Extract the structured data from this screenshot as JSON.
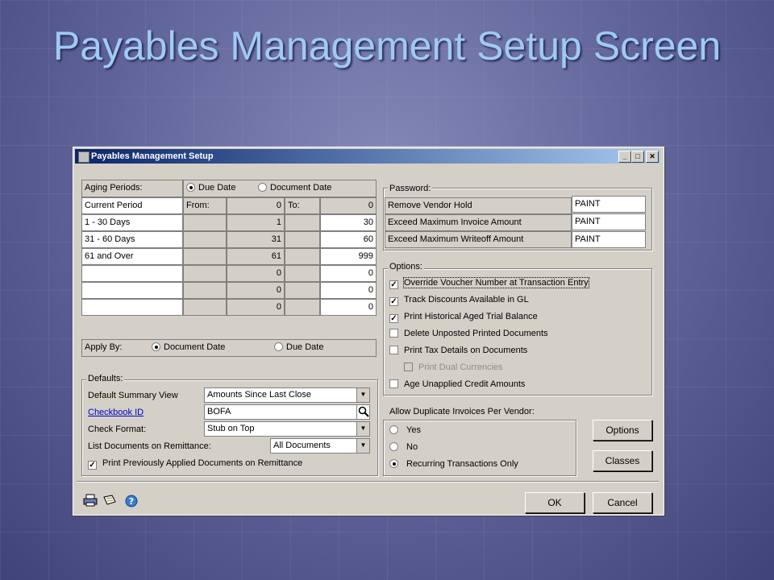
{
  "slide": {
    "title": "Payables Management Setup Screen"
  },
  "window": {
    "title": "Payables Management Setup",
    "min": "_",
    "max": "□",
    "close": "✕"
  },
  "aging": {
    "label": "Aging Periods:",
    "due_date": "Due Date",
    "document_date": "Document Date",
    "from_label": "From:",
    "to_label": "To:",
    "rows": [
      {
        "name": "Current Period",
        "from": "0",
        "to": "0"
      },
      {
        "name": "1 - 30 Days",
        "from": "1",
        "to": "30"
      },
      {
        "name": "31 - 60 Days",
        "from": "31",
        "to": "60"
      },
      {
        "name": "61 and Over",
        "from": "61",
        "to": "999"
      },
      {
        "name": "",
        "from": "0",
        "to": "0"
      },
      {
        "name": "",
        "from": "0",
        "to": "0"
      },
      {
        "name": "",
        "from": "0",
        "to": "0"
      }
    ]
  },
  "apply_by": {
    "label": "Apply By:",
    "document_date": "Document Date",
    "due_date": "Due Date"
  },
  "defaults": {
    "label": "Defaults:",
    "summary_view_label": "Default Summary View",
    "summary_view_value": "Amounts Since Last Close",
    "checkbook_label": "Checkbook ID",
    "checkbook_value": "BOFA",
    "check_format_label": "Check Format:",
    "check_format_value": "Stub on Top",
    "list_docs_label": "List Documents on Remittance:",
    "list_docs_value": "All Documents",
    "print_prev_label": "Print Previously Applied Documents on Remittance"
  },
  "password": {
    "label": "Password:",
    "rows": [
      {
        "name": "Remove Vendor Hold",
        "value": "PAINT"
      },
      {
        "name": "Exceed Maximum Invoice Amount",
        "value": "PAINT"
      },
      {
        "name": "Exceed Maximum Writeoff Amount",
        "value": "PAINT"
      }
    ]
  },
  "options": {
    "label": "Options:",
    "items": [
      "Override Voucher Number at Transaction Entry",
      "Track Discounts Available in GL",
      "Print Historical Aged Trial Balance",
      "Delete Unposted Printed Documents",
      "Print Tax Details on Documents",
      "Print Dual Currencies",
      "Age Unapplied Credit Amounts"
    ]
  },
  "duplicates": {
    "label": "Allow Duplicate Invoices Per Vendor:",
    "yes": "Yes",
    "no": "No",
    "recurring": "Recurring Transactions Only"
  },
  "buttons": {
    "options": "Options",
    "classes": "Classes",
    "ok": "OK",
    "cancel": "Cancel"
  },
  "icons": [
    "printer-icon",
    "notes-icon",
    "help-icon"
  ]
}
